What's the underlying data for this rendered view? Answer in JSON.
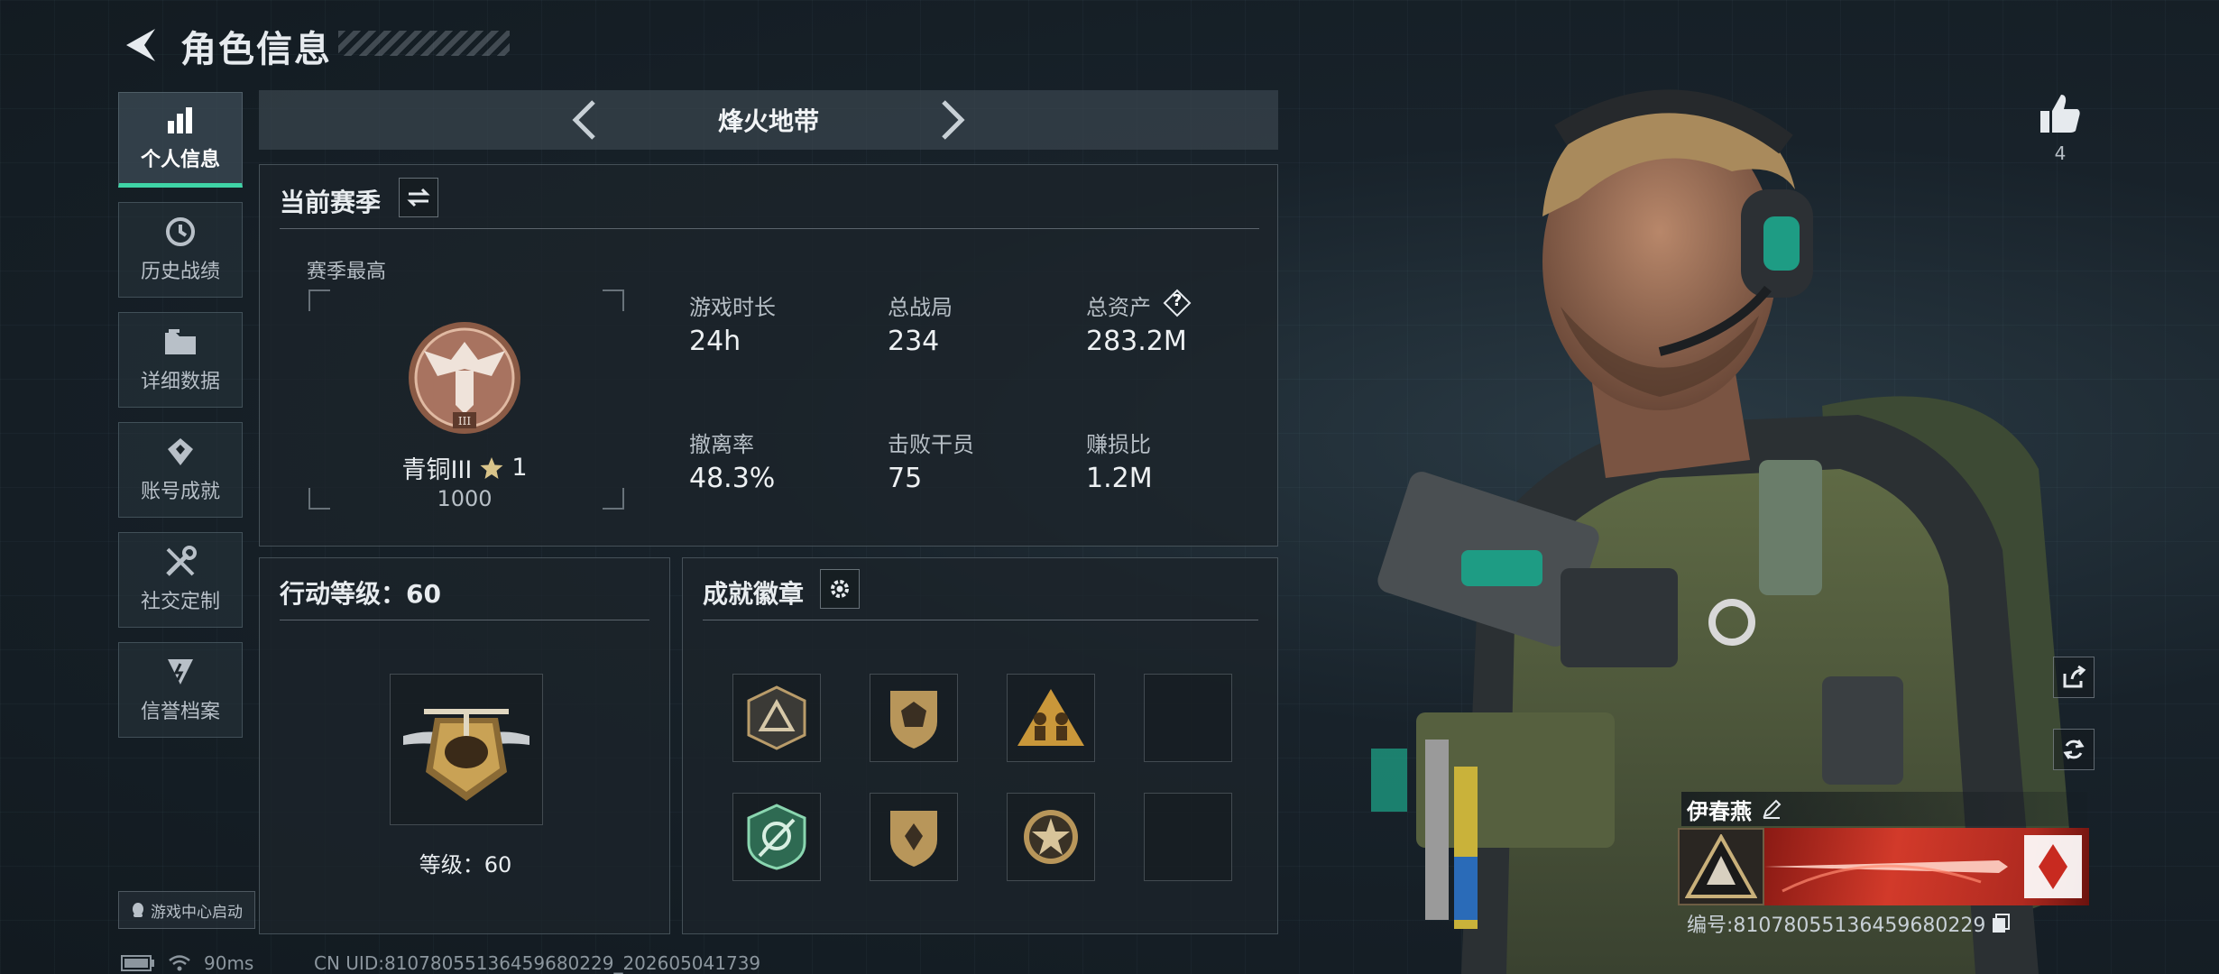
{
  "header": {
    "title": "角色信息"
  },
  "sidebar": {
    "items": [
      {
        "label": "个人信息",
        "icon": "bar-chart-icon"
      },
      {
        "label": "历史战绩",
        "icon": "history-icon"
      },
      {
        "label": "详细数据",
        "icon": "folder-icon"
      },
      {
        "label": "账号成就",
        "icon": "achievement-icon"
      },
      {
        "label": "社交定制",
        "icon": "tools-icon"
      },
      {
        "label": "信誉档案",
        "icon": "credit-icon"
      }
    ],
    "launch_label": "游戏中心启动"
  },
  "mode": {
    "title": "烽火地带"
  },
  "season": {
    "title": "当前赛季",
    "best_label": "赛季最高",
    "rank_name": "青铜III",
    "rank_stars": "1",
    "rank_points": "1000",
    "stats": [
      {
        "label": "游戏时长",
        "value": "24h"
      },
      {
        "label": "总战局",
        "value": "234"
      },
      {
        "label": "总资产",
        "value": "283.2M",
        "help": "?"
      },
      {
        "label": "撤离率",
        "value": "48.3%"
      },
      {
        "label": "击败干员",
        "value": "75"
      },
      {
        "label": "赚损比",
        "value": "1.2M"
      }
    ]
  },
  "action_level": {
    "title": "行动等级：60",
    "level_text": "等级：60"
  },
  "badges": {
    "title": "成就徽章",
    "items": [
      "triangle-badge-icon",
      "shield-dice-badge-icon",
      "soldiers-badge-icon",
      "empty-slot",
      "green-crest-badge-icon",
      "shield-badge-icon",
      "star-badge-icon",
      "empty-slot"
    ]
  },
  "status": {
    "ping": "90ms",
    "uid_line": "CN UID:810780551364596802​29_202605041739"
  },
  "player": {
    "likes": "4",
    "name": "伊春燕",
    "id_line": "编号:810780551364596802​29"
  },
  "colors": {
    "accent": "#3fd4a6",
    "banner_red": "#d23a2a"
  }
}
